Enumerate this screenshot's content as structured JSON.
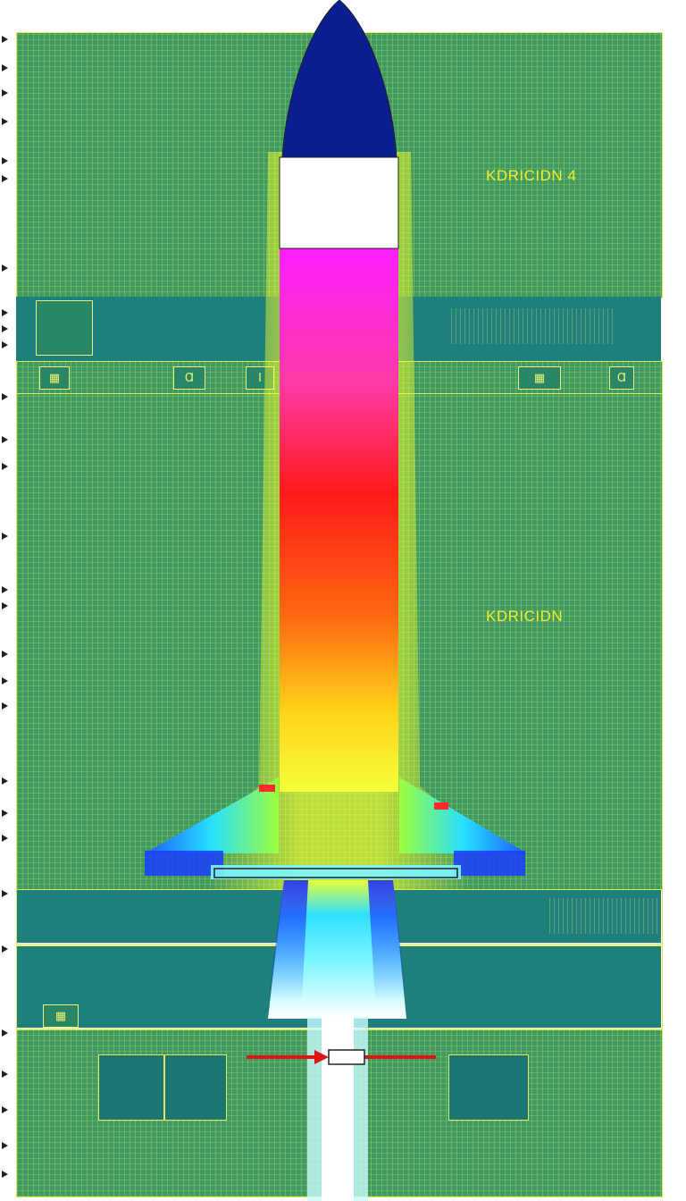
{
  "labels": {
    "top_right": "KDRICIDN 4",
    "middle_right": "KDRICIDN"
  },
  "colors": {
    "board_green": "#3f9a63",
    "teal": "#1f7f7a",
    "trace_yellow": "#d8ec5a",
    "nose_navy": "#0a1f8f",
    "label_yellow": "#f2ea2a",
    "arrow_red": "#e01515"
  },
  "icons": [
    "pin-marker-icon",
    "arrow-right-icon"
  ]
}
